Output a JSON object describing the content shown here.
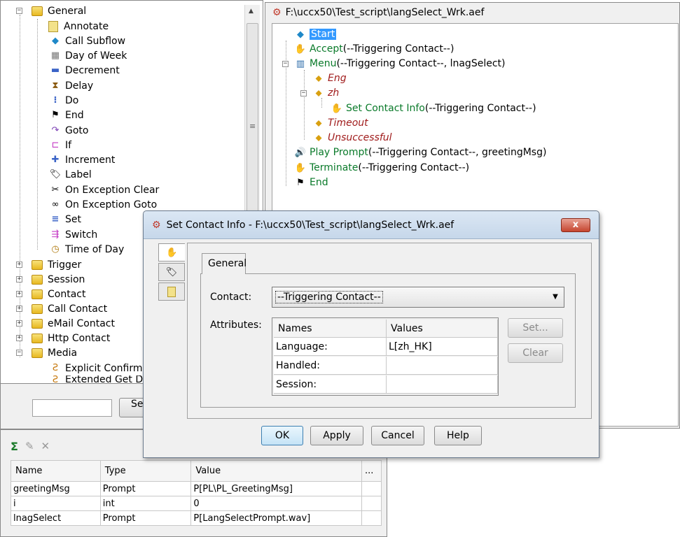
{
  "palette": {
    "general_label": "General",
    "items": [
      "Annotate",
      "Call Subflow",
      "Day of Week",
      "Decrement",
      "Delay",
      "Do",
      "End",
      "Goto",
      "If",
      "Increment",
      "Label",
      "On Exception Clear",
      "On Exception Goto",
      "Set",
      "Switch",
      "Time of Day"
    ],
    "folders": [
      "Trigger",
      "Session",
      "Contact",
      "Call Contact",
      "eMail Contact",
      "Http Contact",
      "Media"
    ],
    "media_items": [
      "Explicit Confirmat",
      "Extended Get Digi"
    ]
  },
  "search": {
    "button_label": "Se",
    "value": ""
  },
  "variables": {
    "columns": [
      "Name",
      "Type",
      "Value",
      "..."
    ],
    "rows": [
      {
        "name": "greetingMsg",
        "type": "Prompt",
        "value": "P[PL\\PL_GreetingMsg]"
      },
      {
        "name": "i",
        "type": "int",
        "value": "0"
      },
      {
        "name": "lnagSelect",
        "type": "Prompt",
        "value": "P[LangSelectPrompt.wav]"
      }
    ]
  },
  "editor": {
    "title": "F:\\uccx50\\Test_script\\langSelect_Wrk.aef",
    "steps": {
      "start": "Start",
      "accept": "Accept",
      "accept_args": " (--Triggering Contact--)",
      "menu": "Menu",
      "menu_args": " (--Triggering Contact--, lnagSelect)",
      "eng": "Eng",
      "zh": "zh",
      "set_contact": "Set Contact Info",
      "set_contact_args": " (--Triggering Contact--)",
      "timeout": "Timeout",
      "unsuccessful": "Unsuccessful",
      "play_prompt": "Play Prompt",
      "play_prompt_args": " (--Triggering Contact--, greetingMsg)",
      "terminate": "Terminate",
      "terminate_args": " (--Triggering Contact--)",
      "end": "End"
    }
  },
  "dialog": {
    "title": "Set Contact Info - F:\\uccx50\\Test_script\\langSelect_Wrk.aef",
    "close_label": "x",
    "tab_general": "General",
    "contact_label": "Contact:",
    "contact_value": "--Triggering Contact--",
    "attributes_label": "Attributes:",
    "attr_columns": [
      "Names",
      "Values"
    ],
    "attr_rows": [
      {
        "name": "Language:",
        "value": "L[zh_HK]"
      },
      {
        "name": "Handled:",
        "value": ""
      },
      {
        "name": "Session:",
        "value": ""
      }
    ],
    "set_button": "Set...",
    "clear_button": "Clear",
    "ok_button": "OK",
    "apply_button": "Apply",
    "cancel_button": "Cancel",
    "help_button": "Help"
  }
}
